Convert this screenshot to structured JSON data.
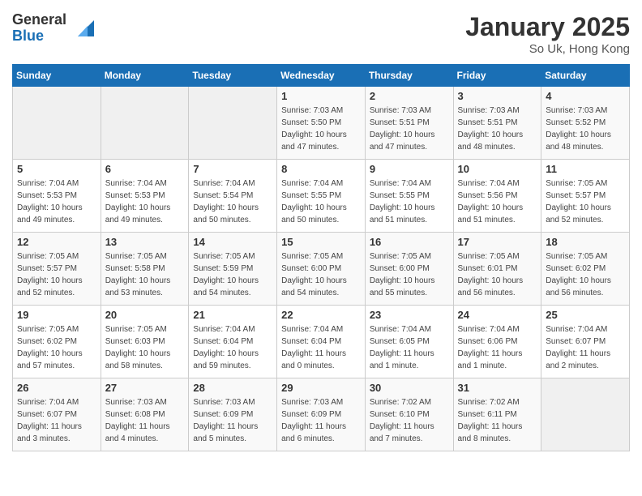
{
  "logo": {
    "general": "General",
    "blue": "Blue"
  },
  "title": "January 2025",
  "location": "So Uk, Hong Kong",
  "days_of_week": [
    "Sunday",
    "Monday",
    "Tuesday",
    "Wednesday",
    "Thursday",
    "Friday",
    "Saturday"
  ],
  "weeks": [
    [
      {
        "day": "",
        "info": ""
      },
      {
        "day": "",
        "info": ""
      },
      {
        "day": "",
        "info": ""
      },
      {
        "day": "1",
        "info": "Sunrise: 7:03 AM\nSunset: 5:50 PM\nDaylight: 10 hours\nand 47 minutes."
      },
      {
        "day": "2",
        "info": "Sunrise: 7:03 AM\nSunset: 5:51 PM\nDaylight: 10 hours\nand 47 minutes."
      },
      {
        "day": "3",
        "info": "Sunrise: 7:03 AM\nSunset: 5:51 PM\nDaylight: 10 hours\nand 48 minutes."
      },
      {
        "day": "4",
        "info": "Sunrise: 7:03 AM\nSunset: 5:52 PM\nDaylight: 10 hours\nand 48 minutes."
      }
    ],
    [
      {
        "day": "5",
        "info": "Sunrise: 7:04 AM\nSunset: 5:53 PM\nDaylight: 10 hours\nand 49 minutes."
      },
      {
        "day": "6",
        "info": "Sunrise: 7:04 AM\nSunset: 5:53 PM\nDaylight: 10 hours\nand 49 minutes."
      },
      {
        "day": "7",
        "info": "Sunrise: 7:04 AM\nSunset: 5:54 PM\nDaylight: 10 hours\nand 50 minutes."
      },
      {
        "day": "8",
        "info": "Sunrise: 7:04 AM\nSunset: 5:55 PM\nDaylight: 10 hours\nand 50 minutes."
      },
      {
        "day": "9",
        "info": "Sunrise: 7:04 AM\nSunset: 5:55 PM\nDaylight: 10 hours\nand 51 minutes."
      },
      {
        "day": "10",
        "info": "Sunrise: 7:04 AM\nSunset: 5:56 PM\nDaylight: 10 hours\nand 51 minutes."
      },
      {
        "day": "11",
        "info": "Sunrise: 7:05 AM\nSunset: 5:57 PM\nDaylight: 10 hours\nand 52 minutes."
      }
    ],
    [
      {
        "day": "12",
        "info": "Sunrise: 7:05 AM\nSunset: 5:57 PM\nDaylight: 10 hours\nand 52 minutes."
      },
      {
        "day": "13",
        "info": "Sunrise: 7:05 AM\nSunset: 5:58 PM\nDaylight: 10 hours\nand 53 minutes."
      },
      {
        "day": "14",
        "info": "Sunrise: 7:05 AM\nSunset: 5:59 PM\nDaylight: 10 hours\nand 54 minutes."
      },
      {
        "day": "15",
        "info": "Sunrise: 7:05 AM\nSunset: 6:00 PM\nDaylight: 10 hours\nand 54 minutes."
      },
      {
        "day": "16",
        "info": "Sunrise: 7:05 AM\nSunset: 6:00 PM\nDaylight: 10 hours\nand 55 minutes."
      },
      {
        "day": "17",
        "info": "Sunrise: 7:05 AM\nSunset: 6:01 PM\nDaylight: 10 hours\nand 56 minutes."
      },
      {
        "day": "18",
        "info": "Sunrise: 7:05 AM\nSunset: 6:02 PM\nDaylight: 10 hours\nand 56 minutes."
      }
    ],
    [
      {
        "day": "19",
        "info": "Sunrise: 7:05 AM\nSunset: 6:02 PM\nDaylight: 10 hours\nand 57 minutes."
      },
      {
        "day": "20",
        "info": "Sunrise: 7:05 AM\nSunset: 6:03 PM\nDaylight: 10 hours\nand 58 minutes."
      },
      {
        "day": "21",
        "info": "Sunrise: 7:04 AM\nSunset: 6:04 PM\nDaylight: 10 hours\nand 59 minutes."
      },
      {
        "day": "22",
        "info": "Sunrise: 7:04 AM\nSunset: 6:04 PM\nDaylight: 11 hours\nand 0 minutes."
      },
      {
        "day": "23",
        "info": "Sunrise: 7:04 AM\nSunset: 6:05 PM\nDaylight: 11 hours\nand 1 minute."
      },
      {
        "day": "24",
        "info": "Sunrise: 7:04 AM\nSunset: 6:06 PM\nDaylight: 11 hours\nand 1 minute."
      },
      {
        "day": "25",
        "info": "Sunrise: 7:04 AM\nSunset: 6:07 PM\nDaylight: 11 hours\nand 2 minutes."
      }
    ],
    [
      {
        "day": "26",
        "info": "Sunrise: 7:04 AM\nSunset: 6:07 PM\nDaylight: 11 hours\nand 3 minutes."
      },
      {
        "day": "27",
        "info": "Sunrise: 7:03 AM\nSunset: 6:08 PM\nDaylight: 11 hours\nand 4 minutes."
      },
      {
        "day": "28",
        "info": "Sunrise: 7:03 AM\nSunset: 6:09 PM\nDaylight: 11 hours\nand 5 minutes."
      },
      {
        "day": "29",
        "info": "Sunrise: 7:03 AM\nSunset: 6:09 PM\nDaylight: 11 hours\nand 6 minutes."
      },
      {
        "day": "30",
        "info": "Sunrise: 7:02 AM\nSunset: 6:10 PM\nDaylight: 11 hours\nand 7 minutes."
      },
      {
        "day": "31",
        "info": "Sunrise: 7:02 AM\nSunset: 6:11 PM\nDaylight: 11 hours\nand 8 minutes."
      },
      {
        "day": "",
        "info": ""
      }
    ]
  ]
}
